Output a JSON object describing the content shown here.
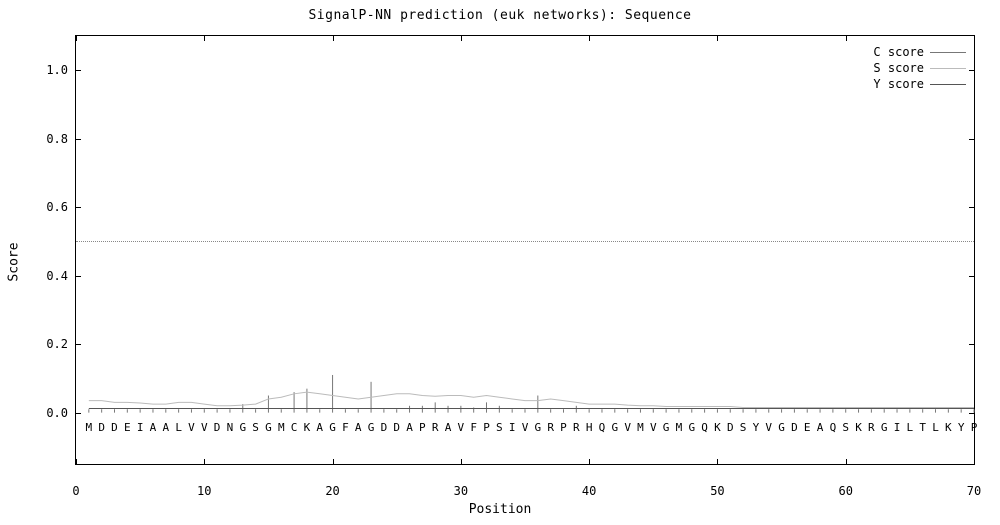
{
  "chart_data": {
    "type": "line",
    "title": "SignalP-NN prediction (euk networks): Sequence",
    "xlabel": "Position",
    "ylabel": "Score",
    "xlim": [
      0,
      70
    ],
    "ylim_visual": [
      -0.15,
      1.1
    ],
    "y_baseline": 0.0,
    "x_ticks": [
      0,
      10,
      20,
      30,
      40,
      50,
      60,
      70
    ],
    "y_ticks": [
      0.0,
      0.2,
      0.4,
      0.6,
      0.8,
      1.0
    ],
    "threshold": 0.5,
    "sequence": "MDDEIAALVVDNGSGMCKAGFAGDDAPRAVFPSIVGRPRHQGVMVGMGQKDSYVGDEAQSKRGILTLKYP",
    "series": [
      {
        "name": "C score",
        "style": "impulse",
        "color": "#777777",
        "values": [
          0.01,
          0.01,
          0.01,
          0.01,
          0.01,
          0.01,
          0.01,
          0.01,
          0.01,
          0.01,
          0.01,
          0.01,
          0.025,
          0.01,
          0.05,
          0.01,
          0.06,
          0.07,
          0.01,
          0.11,
          0.01,
          0.01,
          0.09,
          0.01,
          0.01,
          0.02,
          0.02,
          0.03,
          0.02,
          0.02,
          0.015,
          0.03,
          0.02,
          0.01,
          0.01,
          0.05,
          0.01,
          0.01,
          0.02,
          0.01,
          0.01,
          0.01,
          0.01,
          0.01,
          0.01,
          0.01,
          0.01,
          0.01,
          0.01,
          0.01,
          0.01,
          0.01,
          0.01,
          0.01,
          0.01,
          0.01,
          0.01,
          0.01,
          0.01,
          0.01,
          0.01,
          0.01,
          0.01,
          0.01,
          0.01,
          0.01,
          0.01,
          0.01,
          0.01,
          0.01
        ]
      },
      {
        "name": "S score",
        "style": "line",
        "color": "#bbbbbb",
        "values": [
          0.035,
          0.035,
          0.03,
          0.03,
          0.028,
          0.025,
          0.025,
          0.03,
          0.03,
          0.025,
          0.02,
          0.02,
          0.022,
          0.025,
          0.04,
          0.045,
          0.055,
          0.06,
          0.055,
          0.05,
          0.045,
          0.04,
          0.045,
          0.05,
          0.055,
          0.055,
          0.05,
          0.048,
          0.05,
          0.05,
          0.045,
          0.05,
          0.045,
          0.04,
          0.035,
          0.035,
          0.04,
          0.035,
          0.03,
          0.025,
          0.025,
          0.025,
          0.022,
          0.02,
          0.02,
          0.018,
          0.018,
          0.018,
          0.018,
          0.018,
          0.018,
          0.015,
          0.015,
          0.015,
          0.015,
          0.015,
          0.015,
          0.015,
          0.015,
          0.015,
          0.015,
          0.015,
          0.015,
          0.015,
          0.015,
          0.015,
          0.015,
          0.015,
          0.015,
          0.015
        ]
      },
      {
        "name": "Y score",
        "style": "line",
        "color": "#555555",
        "values": [
          0.012,
          0.012,
          0.012,
          0.012,
          0.012,
          0.012,
          0.012,
          0.012,
          0.012,
          0.012,
          0.012,
          0.012,
          0.012,
          0.012,
          0.012,
          0.012,
          0.012,
          0.012,
          0.012,
          0.012,
          0.012,
          0.012,
          0.012,
          0.012,
          0.012,
          0.012,
          0.012,
          0.012,
          0.012,
          0.012,
          0.012,
          0.012,
          0.012,
          0.012,
          0.012,
          0.012,
          0.012,
          0.012,
          0.012,
          0.012,
          0.012,
          0.012,
          0.012,
          0.012,
          0.012,
          0.012,
          0.012,
          0.012,
          0.012,
          0.012,
          0.012,
          0.012,
          0.012,
          0.012,
          0.012,
          0.012,
          0.012,
          0.012,
          0.012,
          0.012,
          0.012,
          0.012,
          0.012,
          0.012,
          0.012,
          0.012,
          0.012,
          0.012,
          0.012,
          0.012
        ]
      }
    ],
    "legend": [
      "C score",
      "S score",
      "Y score"
    ]
  }
}
